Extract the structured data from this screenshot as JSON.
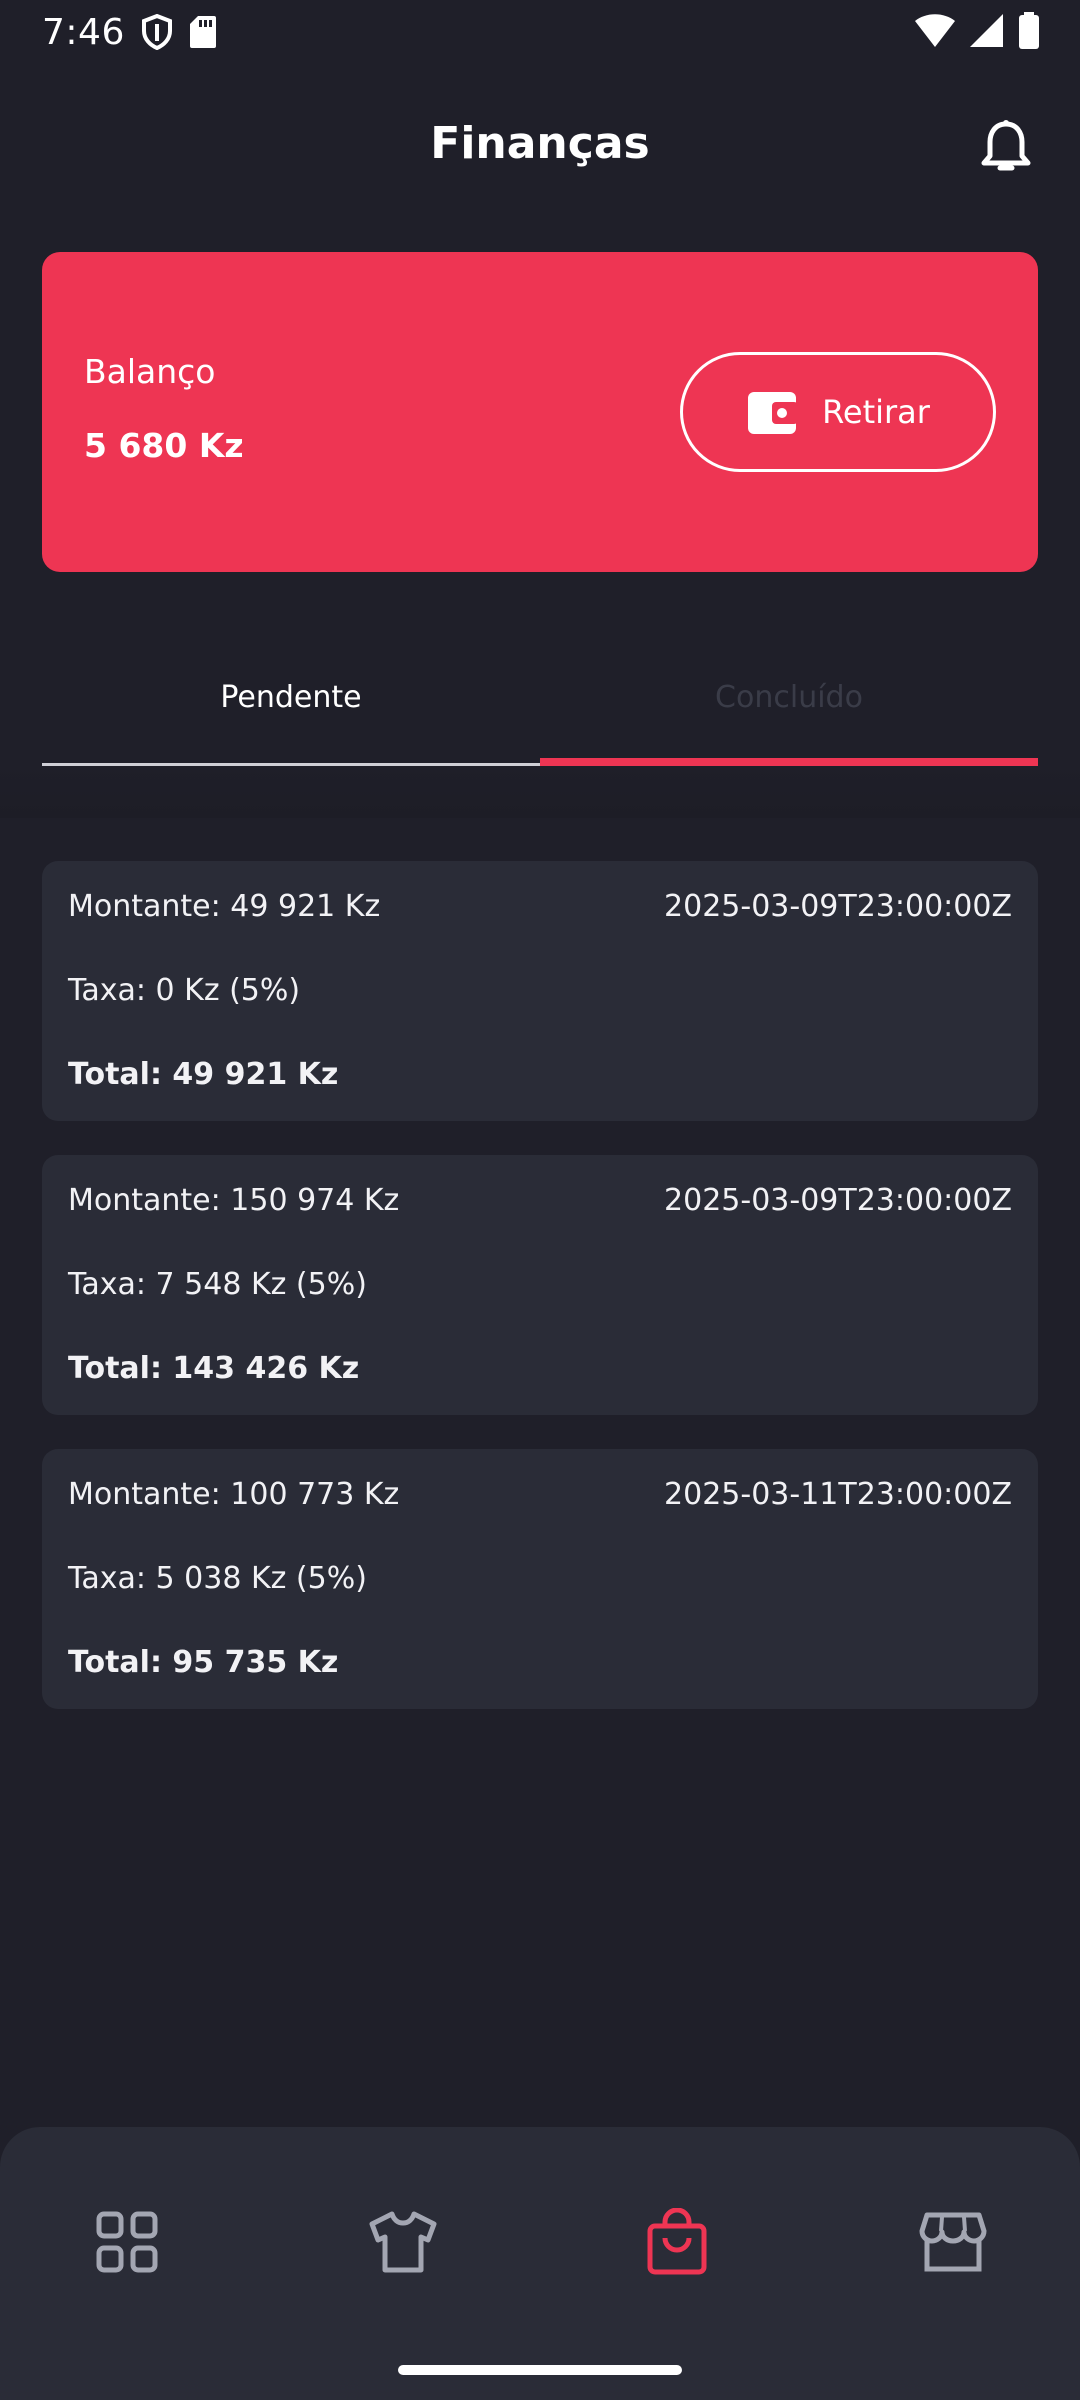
{
  "status_bar": {
    "time": "7:46",
    "icons": [
      "shield-icon",
      "sd-card-icon",
      "wifi-icon",
      "signal-icon",
      "battery-icon"
    ]
  },
  "header": {
    "title": "Finanças",
    "notification_icon": "bell-icon"
  },
  "balance": {
    "label": "Balanço",
    "value": "5 680 Kz",
    "withdraw_label": "Retirar",
    "withdraw_icon": "wallet-icon"
  },
  "tabs": [
    {
      "label": "Pendente",
      "selected": false
    },
    {
      "label": "Concluído",
      "selected": true
    }
  ],
  "transactions": [
    {
      "amount": "Montante: 49 921 Kz",
      "date": "2025-03-09T23:00:00Z",
      "fee": "Taxa: 0 Kz (5%)",
      "total": "Total: 49 921 Kz"
    },
    {
      "amount": "Montante: 150 974 Kz",
      "date": "2025-03-09T23:00:00Z",
      "fee": "Taxa: 7 548 Kz (5%)",
      "total": "Total: 143 426 Kz"
    },
    {
      "amount": "Montante: 100 773 Kz",
      "date": "2025-03-11T23:00:00Z",
      "fee": "Taxa: 5 038 Kz (5%)",
      "total": "Total: 95 735 Kz"
    }
  ],
  "bottom_nav": [
    {
      "icon": "grid-icon",
      "active": false
    },
    {
      "icon": "shirt-icon",
      "active": false
    },
    {
      "icon": "shopping-bag-icon",
      "active": true
    },
    {
      "icon": "store-icon",
      "active": false
    }
  ],
  "colors": {
    "background": "#1f1f29",
    "card": "#2a2c37",
    "accent": "#ee3553",
    "text": "#ffffff"
  }
}
